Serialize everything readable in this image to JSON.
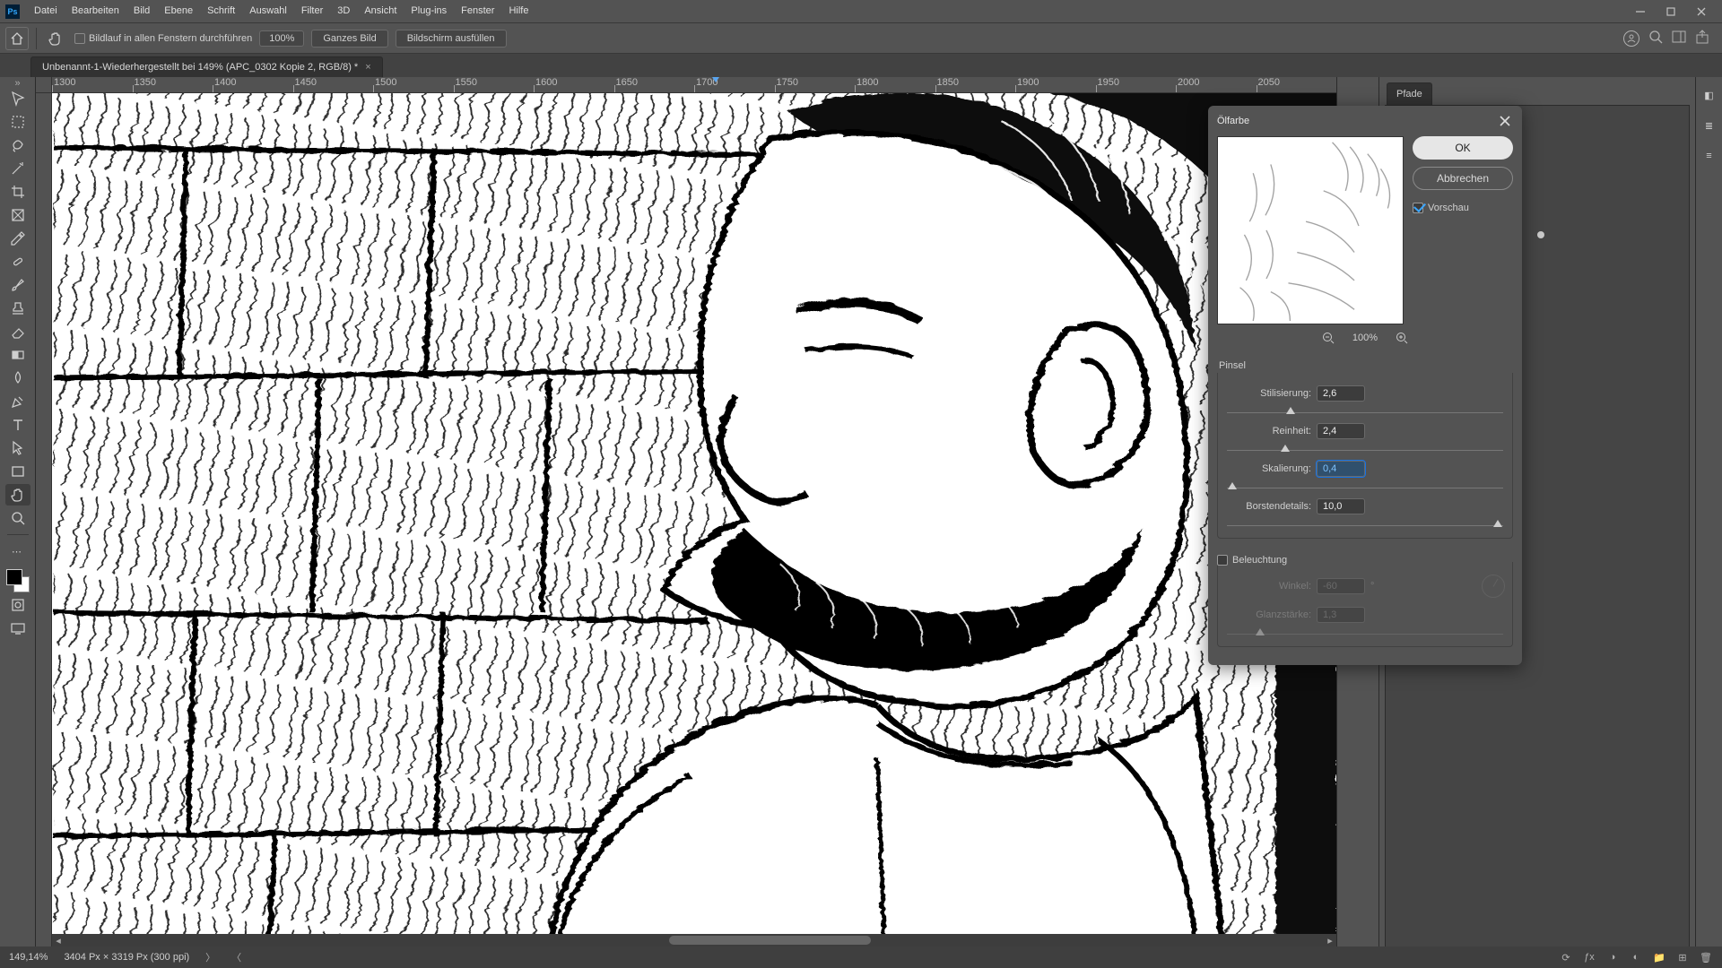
{
  "menu": {
    "items": [
      "Datei",
      "Bearbeiten",
      "Bild",
      "Ebene",
      "Schrift",
      "Auswahl",
      "Filter",
      "3D",
      "Ansicht",
      "Plug-ins",
      "Fenster",
      "Hilfe"
    ]
  },
  "optbar": {
    "scroll_all_label": "Bildlauf in allen Fenstern durchführen",
    "zoom_value": "100%",
    "fit_whole": "Ganzes Bild",
    "fit_screen": "Bildschirm ausfüllen"
  },
  "tab": {
    "title": "Unbenannt-1-Wiederhergestellt bei 149% (APC_0302 Kopie 2, RGB/8) *"
  },
  "ruler": {
    "ticks": [
      "1300",
      "1350",
      "1400",
      "1450",
      "1500",
      "1550",
      "1600",
      "1650",
      "1700",
      "1750",
      "1800",
      "1850",
      "1900",
      "1950",
      "2000",
      "2050"
    ]
  },
  "right_panel": {
    "tab": "Pfade"
  },
  "dlg": {
    "title": "Ölfarbe",
    "ok": "OK",
    "cancel": "Abbrechen",
    "preview_label": "Vorschau",
    "zoom": "100%",
    "group_brush": "Pinsel",
    "stylization_label": "Stilisierung:",
    "stylization_value": "2,6",
    "cleanliness_label": "Reinheit:",
    "cleanliness_value": "2,4",
    "scale_label": "Skalierung:",
    "scale_value": "0,4",
    "bristle_label": "Borstendetails:",
    "bristle_value": "10,0",
    "lighting_label": "Beleuchtung",
    "angle_label": "Winkel:",
    "angle_value": "-60",
    "angle_unit": "°",
    "shine_label": "Glanzstärke:",
    "shine_value": "1,3"
  },
  "status": {
    "zoom": "149,14%",
    "dims": "3404 Px × 3319 Px (300 ppi)"
  }
}
